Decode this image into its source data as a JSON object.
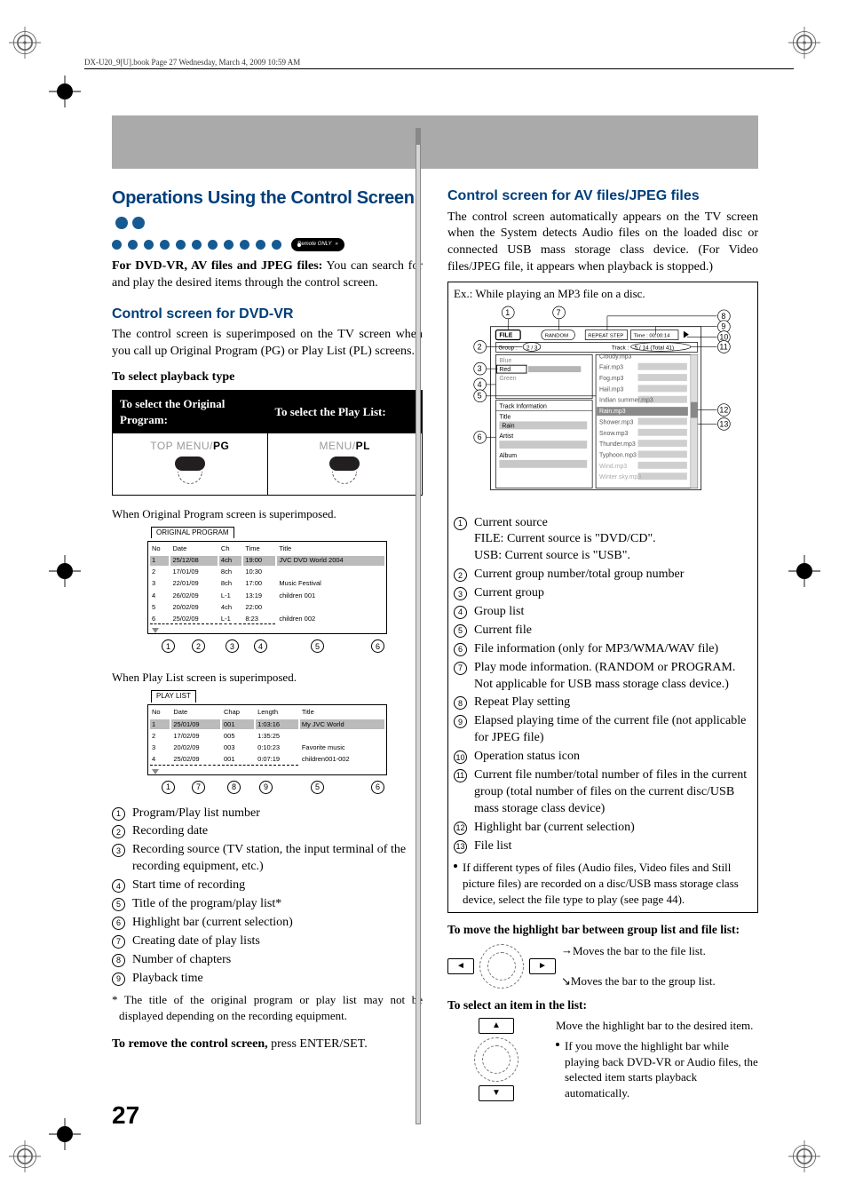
{
  "header": {
    "line": "DX-U20_9[U].book  Page 27  Wednesday, March 4, 2009  10:59 AM"
  },
  "left": {
    "title": "Operations Using the Control Screen",
    "remote_tag": "Remote ONLY",
    "intro_bold": "For DVD-VR, AV files and JPEG files:",
    "intro_rest": " You can search for and play the desired items through the control screen.",
    "dvdvr_title": "Control screen for DVD-VR",
    "dvdvr_desc": "The control screen is superimposed on the TV screen when you call up Original Program (PG) or Play List (PL) screens.",
    "select_playback": "To select playback type",
    "th1": "To select the Original Program:",
    "th2": "To select the Play List:",
    "btn1_pre": "TOP MENU/",
    "btn1_em": "PG",
    "btn2_pre": "MENU/",
    "btn2_em": "PL",
    "cap_orig": "When Original Program screen is superimposed.",
    "orig_tab": "ORIGINAL PROGRAM",
    "orig_headers": [
      "No",
      "Date",
      "Ch",
      "Time",
      "Title"
    ],
    "orig_rows": [
      [
        "1",
        "25/12/08",
        "4ch",
        "19:00",
        "JVC DVD World 2004"
      ],
      [
        "2",
        "17/01/09",
        "8ch",
        "10:30",
        ""
      ],
      [
        "3",
        "22/01/09",
        "8ch",
        "17:00",
        "Music Festival"
      ],
      [
        "4",
        "26/02/09",
        "L-1",
        "13:19",
        "children 001"
      ],
      [
        "5",
        "20/02/09",
        "4ch",
        "22:00",
        ""
      ],
      [
        "6",
        "25/02/09",
        "L-1",
        "8:23",
        "children 002"
      ]
    ],
    "cap_pl": "When Play List screen is superimposed.",
    "pl_tab": "PLAY LIST",
    "pl_headers": [
      "No",
      "Date",
      "Chap",
      "Length",
      "Title"
    ],
    "pl_rows": [
      [
        "1",
        "25/01/09",
        "001",
        "1:03:16",
        "My JVC World"
      ],
      [
        "2",
        "17/02/09",
        "005",
        "1:35:25",
        ""
      ],
      [
        "3",
        "20/02/09",
        "003",
        "0:10:23",
        "Favorite music"
      ],
      [
        "4",
        "25/02/09",
        "001",
        "0:07:19",
        "children001-002"
      ]
    ],
    "enum": [
      "Program/Play list number",
      "Recording date",
      "Recording source (TV station, the input terminal of the recording equipment, etc.)",
      "Start time of recording",
      "Title of the program/play list*",
      "Highlight bar (current selection)",
      "Creating date of play lists",
      "Number of chapters",
      "Playback time"
    ],
    "footnote": "* The title of the original program or play list may not be displayed depending on the recording equipment.",
    "remove_bold": "To remove the control screen,",
    "remove_rest": " press ENTER/SET."
  },
  "right": {
    "title": "Control screen for AV files/JPEG files",
    "desc": "The control screen automatically appears on the TV screen when the System detects Audio files on the loaded disc or connected USB mass storage class device. (For Video files/JPEG file, it appears when playback is stopped.)",
    "ex_label": "Ex.: While playing an MP3 file on a disc.",
    "panel": {
      "file_btn": "FILE",
      "random": "RANDOM",
      "repeat": "REPEAT STEP",
      "time": "Time : 00:00:14",
      "group_label": "Group :",
      "group_val": "2 / 3",
      "track_label": "Track :",
      "track_val": "5 / 14 (Total 41)",
      "groups": [
        "Blue",
        "Red",
        "Green"
      ],
      "file_info_hdr": "Track Information",
      "file_info": [
        [
          "Title",
          "Rain"
        ],
        [
          "Artist",
          ""
        ],
        [
          "Album",
          ""
        ]
      ],
      "files": [
        "Cloudy.mp3",
        "Fair.mp3",
        "Fog.mp3",
        "Hail.mp3",
        "Indian summer.mp3",
        "Rain.mp3",
        "Shower.mp3",
        "Snow.mp3",
        "Thunder.mp3",
        "Typhoon.mp3",
        "Wind.mp3",
        "Winter sky.mp3"
      ]
    },
    "enum": [
      "Current source",
      "Current group number/total group number",
      "Current group",
      "Group list",
      "Current file",
      "File information (only for MP3/WMA/WAV file)",
      "Play mode information. (RANDOM or PROGRAM. Not applicable for USB mass storage class device.)",
      "Repeat Play setting",
      "Elapsed playing time of the current file (not applicable for JPEG file)",
      "Operation status icon",
      "Current file number/total number of files in the current group (total number of files on the current disc/USB mass storage class device)",
      "Highlight bar (current selection)",
      "File list"
    ],
    "enum1_extra1": "FILE: Current source is \"DVD/CD\".",
    "enum1_extra2": "USB: Current source is \"USB\".",
    "bullet": "If different types of files (Audio files, Video files and Still picture files) are recorded on a disc/USB mass storage class device, select the file type to play (see page 44).",
    "move_title": "To move the highlight bar between group list and file list:",
    "move_r1": "Moves the bar to the file list.",
    "move_r2": "Moves the bar to the group list.",
    "sel_title": "To select an item in the list:",
    "sel_desc1": "Move the highlight bar to the desired item.",
    "sel_bullet": "If you move the highlight bar while playing back DVD-VR or Audio files, the selected item starts playback automatically."
  },
  "pagenum": "27"
}
